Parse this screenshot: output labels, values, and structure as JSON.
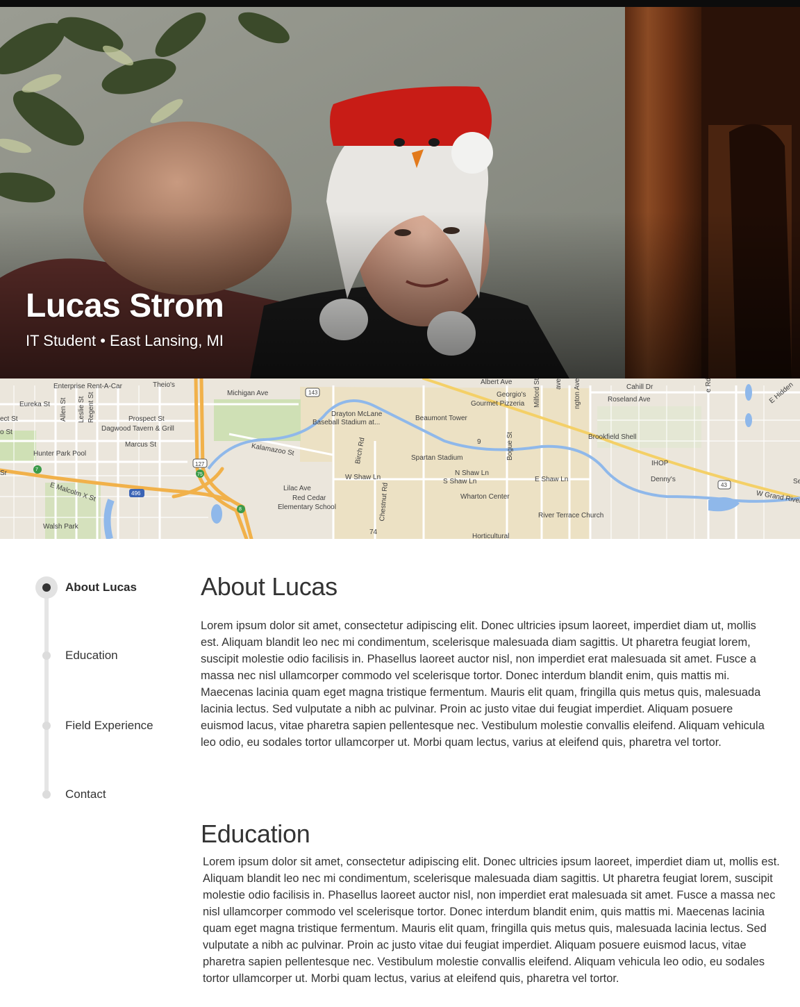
{
  "profile": {
    "name": "Lucas Strom",
    "subtitle": "IT Student • East Lansing, MI"
  },
  "map": {
    "labels": [
      "Enterprise Rent-A-Car",
      "Theio's",
      "Michigan Ave",
      "143",
      "Albert Ave",
      "Georgio's",
      "Gourmet Pizzeria",
      "Milford St",
      "Cahill Dr",
      "Roseland Ave",
      "E Hidden",
      "Eureka St",
      "Allen St",
      "Leslie St",
      "Regent St",
      "Prospect St",
      "Dagwood Tavern & Grill",
      "Drayton McLane",
      "Baseball Stadium at...",
      "Beaumont Tower",
      "Marcus St",
      "Kalamazoo St",
      "Birch Rd",
      "Spartan Stadium",
      "Bogue St",
      "Brookfield Shell",
      "Hunter Park Pool",
      "127",
      "75",
      "W Shaw Ln",
      "N Shaw Ln",
      "S Shaw Ln",
      "E Shaw Ln",
      "IHOP",
      "Denny's",
      "43",
      "E Malcolm X St",
      "496",
      "Lilac Ave",
      "Red Cedar",
      "Elementary School",
      "Wharton Center",
      "Chestnut Rd",
      "River Terrace Church",
      "W Grand River",
      "Walsh Park",
      "74",
      "Horticultural",
      "9",
      "8",
      "7",
      "ect St",
      "o St",
      "Sr",
      "ave",
      "ngton Ave",
      "e Rd",
      "Se"
    ]
  },
  "nav": {
    "items": [
      {
        "label": "About Lucas"
      },
      {
        "label": "Education"
      },
      {
        "label": "Field Experience"
      },
      {
        "label": "Contact"
      }
    ]
  },
  "sections": {
    "about": {
      "title": "About Lucas",
      "body": "Lorem ipsum dolor sit amet, consectetur adipiscing elit. Donec ultricies ipsum laoreet, imperdiet diam ut, mollis est. Aliquam blandit leo nec mi condimentum, scelerisque malesuada diam sagittis. Ut pharetra feugiat lorem, suscipit molestie odio facilisis in. Phasellus laoreet auctor nisl, non imperdiet erat malesuada sit amet. Fusce a massa nec nisl ullamcorper commodo vel scelerisque tortor. Donec interdum blandit enim, quis mattis mi. Maecenas lacinia quam eget magna tristique fermentum. Mauris elit quam, fringilla quis metus quis, malesuada lacinia lectus. Sed vulputate a nibh ac pulvinar. Proin ac justo vitae dui feugiat imperdiet. Aliquam posuere euismod lacus, vitae pharetra sapien pellentesque nec. Vestibulum molestie convallis eleifend. Aliquam vehicula leo odio, eu sodales tortor ullamcorper ut. Morbi quam lectus, varius at eleifend quis, pharetra vel tortor."
    },
    "education": {
      "title": "Education",
      "body": "Lorem ipsum dolor sit amet, consectetur adipiscing elit. Donec ultricies ipsum laoreet, imperdiet diam ut, mollis est. Aliquam blandit leo nec mi condimentum, scelerisque malesuada diam sagittis. Ut pharetra feugiat lorem, suscipit molestie odio facilisis in. Phasellus laoreet auctor nisl, non imperdiet erat malesuada sit amet. Fusce a massa nec nisl ullamcorper commodo vel scelerisque tortor. Donec interdum blandit enim, quis mattis mi. Maecenas lacinia quam eget magna tristique fermentum. Mauris elit quam, fringilla quis metus quis, malesuada lacinia lectus. Sed vulputate a nibh ac pulvinar. Proin ac justo vitae dui feugiat imperdiet. Aliquam posuere euismod lacus, vitae pharetra sapien pellentesque nec. Vestibulum molestie convallis eleifend. Aliquam vehicula leo odio, eu sodales tortor ullamcorper ut. Morbi quam lectus, varius at eleifend quis, pharetra vel tortor."
    }
  }
}
